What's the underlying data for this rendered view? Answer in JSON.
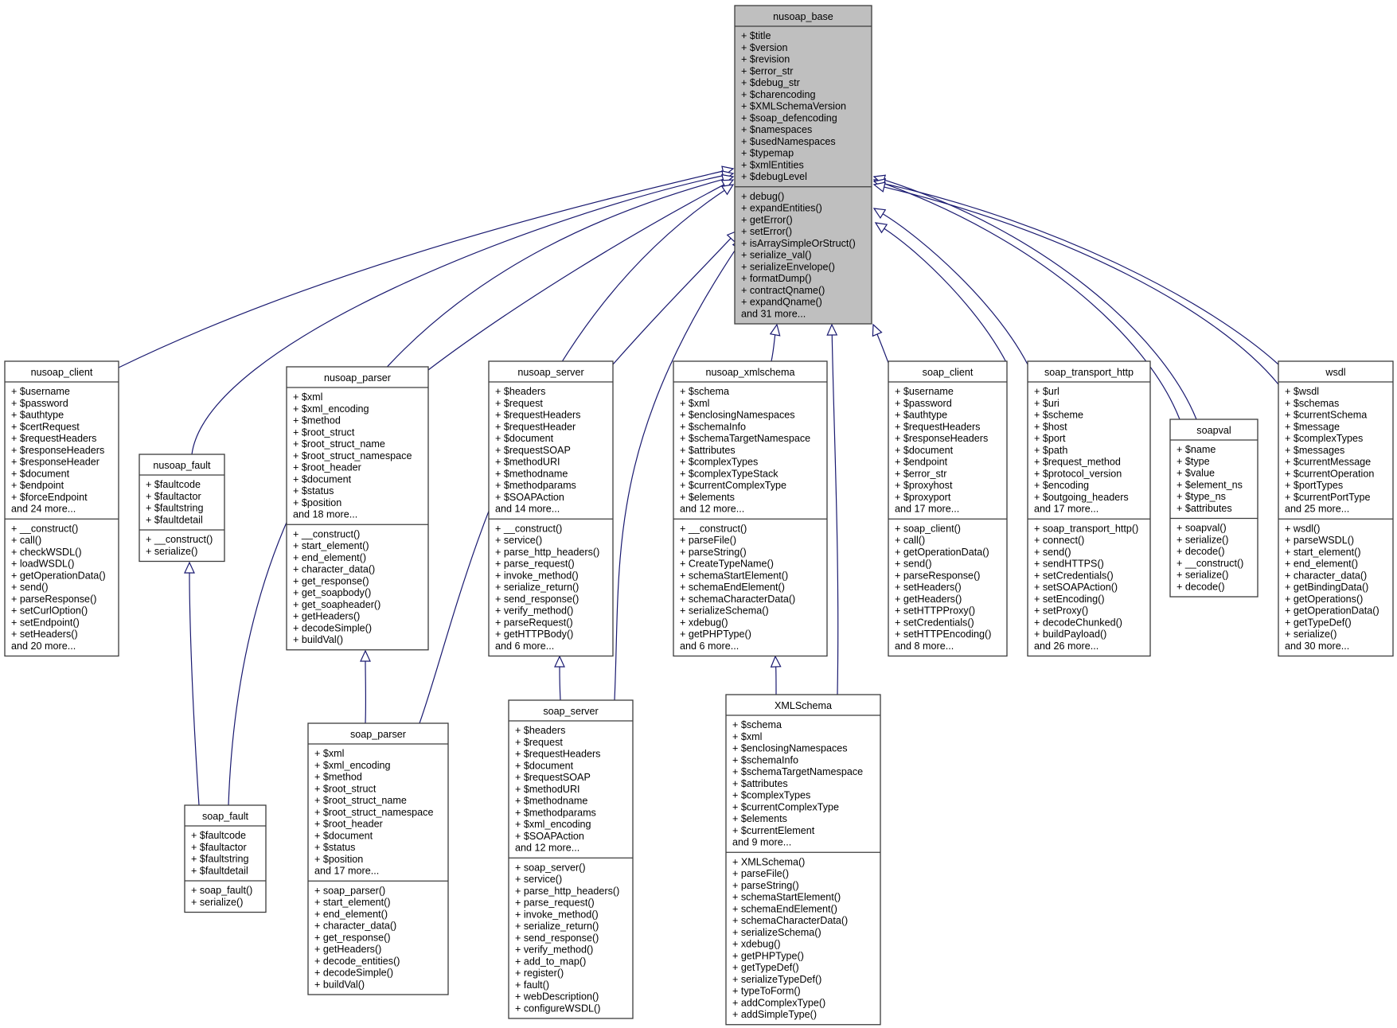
{
  "diagram": {
    "type": "uml-class-inheritance",
    "colors": {
      "edge": "#191970",
      "base_fill": "#bfbfbf",
      "box_fill": "#ffffff",
      "border": "#3c3c3c"
    },
    "classes": [
      {
        "id": "nusoap_base",
        "name": "nusoap_base",
        "highlight": true,
        "attributes": [
          "+ $title",
          "+ $version",
          "+ $revision",
          "+ $error_str",
          "+ $debug_str",
          "+ $charencoding",
          "+ $XMLSchemaVersion",
          "+ $soap_defencoding",
          "+ $namespaces",
          "+ $usedNamespaces",
          "+ $typemap",
          "+ $xmlEntities",
          "+ $debugLevel"
        ],
        "methods": [
          "+ debug()",
          "+ expandEntities()",
          "+ getError()",
          "+ setError()",
          "+ isArraySimpleOrStruct()",
          "+ serialize_val()",
          "+ serializeEnvelope()",
          "+ formatDump()",
          "+ contractQname()",
          "+ expandQname()",
          "and 31 more..."
        ]
      },
      {
        "id": "nusoap_client",
        "name": "nusoap_client",
        "attributes": [
          "+ $username",
          "+ $password",
          "+ $authtype",
          "+ $certRequest",
          "+ $requestHeaders",
          "+ $responseHeaders",
          "+ $responseHeader",
          "+ $document",
          "+ $endpoint",
          "+ $forceEndpoint",
          "and 24 more..."
        ],
        "methods": [
          "+ __construct()",
          "+ call()",
          "+ checkWSDL()",
          "+ loadWSDL()",
          "+ getOperationData()",
          "+ send()",
          "+ parseResponse()",
          "+ setCurlOption()",
          "+ setEndpoint()",
          "+ setHeaders()",
          "and 20 more..."
        ]
      },
      {
        "id": "nusoap_fault",
        "name": "nusoap_fault",
        "attributes": [
          "+ $faultcode",
          "+ $faultactor",
          "+ $faultstring",
          "+ $faultdetail"
        ],
        "methods": [
          "+ __construct()",
          "+ serialize()"
        ]
      },
      {
        "id": "nusoap_parser",
        "name": "nusoap_parser",
        "attributes": [
          "+ $xml",
          "+ $xml_encoding",
          "+ $method",
          "+ $root_struct",
          "+ $root_struct_name",
          "+ $root_struct_namespace",
          "+ $root_header",
          "+ $document",
          "+ $status",
          "+ $position",
          "and 18 more..."
        ],
        "methods": [
          "+ __construct()",
          "+ start_element()",
          "+ end_element()",
          "+ character_data()",
          "+ get_response()",
          "+ get_soapbody()",
          "+ get_soapheader()",
          "+ getHeaders()",
          "+ decodeSimple()",
          "+ buildVal()"
        ]
      },
      {
        "id": "nusoap_server",
        "name": "nusoap_server",
        "attributes": [
          "+ $headers",
          "+ $request",
          "+ $requestHeaders",
          "+ $requestHeader",
          "+ $document",
          "+ $requestSOAP",
          "+ $methodURI",
          "+ $methodname",
          "+ $methodparams",
          "+ $SOAPAction",
          "and 14 more..."
        ],
        "methods": [
          "+ __construct()",
          "+ service()",
          "+ parse_http_headers()",
          "+ parse_request()",
          "+ invoke_method()",
          "+ serialize_return()",
          "+ send_response()",
          "+ verify_method()",
          "+ parseRequest()",
          "+ getHTTPBody()",
          "and 6 more..."
        ]
      },
      {
        "id": "nusoap_xmlschema",
        "name": "nusoap_xmlschema",
        "attributes": [
          "+ $schema",
          "+ $xml",
          "+ $enclosingNamespaces",
          "+ $schemaInfo",
          "+ $schemaTargetNamespace",
          "+ $attributes",
          "+ $complexTypes",
          "+ $complexTypeStack",
          "+ $currentComplexType",
          "+ $elements",
          "and 12 more..."
        ],
        "methods": [
          "+ __construct()",
          "+ parseFile()",
          "+ parseString()",
          "+ CreateTypeName()",
          "+ schemaStartElement()",
          "+ schemaEndElement()",
          "+ schemaCharacterData()",
          "+ serializeSchema()",
          "+ xdebug()",
          "+ getPHPType()",
          "and 6 more..."
        ]
      },
      {
        "id": "soap_client",
        "name": "soap_client",
        "attributes": [
          "+ $username",
          "+ $password",
          "+ $authtype",
          "+ $requestHeaders",
          "+ $responseHeaders",
          "+ $document",
          "+ $endpoint",
          "+ $error_str",
          "+ $proxyhost",
          "+ $proxyport",
          "and 17 more..."
        ],
        "methods": [
          "+ soap_client()",
          "+ call()",
          "+ getOperationData()",
          "+ send()",
          "+ parseResponse()",
          "+ setHeaders()",
          "+ getHeaders()",
          "+ setHTTPProxy()",
          "+ setCredentials()",
          "+ setHTTPEncoding()",
          "and 8 more..."
        ]
      },
      {
        "id": "soap_transport_http",
        "name": "soap_transport_http",
        "attributes": [
          "+ $url",
          "+ $uri",
          "+ $scheme",
          "+ $host",
          "+ $port",
          "+ $path",
          "+ $request_method",
          "+ $protocol_version",
          "+ $encoding",
          "+ $outgoing_headers",
          "and 17 more..."
        ],
        "methods": [
          "+ soap_transport_http()",
          "+ connect()",
          "+ send()",
          "+ sendHTTPS()",
          "+ setCredentials()",
          "+ setSOAPAction()",
          "+ setEncoding()",
          "+ setProxy()",
          "+ decodeChunked()",
          "+ buildPayload()",
          "and 26 more..."
        ]
      },
      {
        "id": "soapval",
        "name": "soapval",
        "attributes": [
          "+ $name",
          "+ $type",
          "+ $value",
          "+ $element_ns",
          "+ $type_ns",
          "+ $attributes"
        ],
        "methods": [
          "+ soapval()",
          "+ serialize()",
          "+ decode()",
          "+ __construct()",
          "+ serialize()",
          "+ decode()"
        ]
      },
      {
        "id": "wsdl",
        "name": "wsdl",
        "attributes": [
          "+ $wsdl",
          "+ $schemas",
          "+ $currentSchema",
          "+ $message",
          "+ $complexTypes",
          "+ $messages",
          "+ $currentMessage",
          "+ $currentOperation",
          "+ $portTypes",
          "+ $currentPortType",
          "and 25 more..."
        ],
        "methods": [
          "+ wsdl()",
          "+ parseWSDL()",
          "+ start_element()",
          "+ end_element()",
          "+ character_data()",
          "+ getBindingData()",
          "+ getOperations()",
          "+ getOperationData()",
          "+ getTypeDef()",
          "+ serialize()",
          "and 30 more..."
        ]
      },
      {
        "id": "soap_fault",
        "name": "soap_fault",
        "attributes": [
          "+ $faultcode",
          "+ $faultactor",
          "+ $faultstring",
          "+ $faultdetail"
        ],
        "methods": [
          "+ soap_fault()",
          "+ serialize()"
        ]
      },
      {
        "id": "soap_parser",
        "name": "soap_parser",
        "attributes": [
          "+ $xml",
          "+ $xml_encoding",
          "+ $method",
          "+ $root_struct",
          "+ $root_struct_name",
          "+ $root_struct_namespace",
          "+ $root_header",
          "+ $document",
          "+ $status",
          "+ $position",
          "and 17 more..."
        ],
        "methods": [
          "+ soap_parser()",
          "+ start_element()",
          "+ end_element()",
          "+ character_data()",
          "+ get_response()",
          "+ getHeaders()",
          "+ decode_entities()",
          "+ decodeSimple()",
          "+ buildVal()"
        ]
      },
      {
        "id": "soap_server",
        "name": "soap_server",
        "attributes": [
          "+ $headers",
          "+ $request",
          "+ $requestHeaders",
          "+ $document",
          "+ $requestSOAP",
          "+ $methodURI",
          "+ $methodname",
          "+ $methodparams",
          "+ $xml_encoding",
          "+ $SOAPAction",
          "and 12 more..."
        ],
        "methods": [
          "+ soap_server()",
          "+ service()",
          "+ parse_http_headers()",
          "+ parse_request()",
          "+ invoke_method()",
          "+ serialize_return()",
          "+ send_response()",
          "+ verify_method()",
          "+ add_to_map()",
          "+ register()",
          "+ fault()",
          "+ webDescription()",
          "+ configureWSDL()"
        ]
      },
      {
        "id": "XMLSchema",
        "name": "XMLSchema",
        "attributes": [
          "+ $schema",
          "+ $xml",
          "+ $enclosingNamespaces",
          "+ $schemaInfo",
          "+ $schemaTargetNamespace",
          "+ $attributes",
          "+ $complexTypes",
          "+ $currentComplexType",
          "+ $elements",
          "+ $currentElement",
          "and 9 more..."
        ],
        "methods": [
          "+ XMLSchema()",
          "+ parseFile()",
          "+ parseString()",
          "+ schemaStartElement()",
          "+ schemaEndElement()",
          "+ schemaCharacterData()",
          "+ serializeSchema()",
          "+ xdebug()",
          "+ getPHPType()",
          "+ getTypeDef()",
          "+ serializeTypeDef()",
          "+ typeToForm()",
          "+ addComplexType()",
          "+ addSimpleType()"
        ]
      }
    ],
    "inheritance": [
      {
        "child": "nusoap_client",
        "parent": "nusoap_base"
      },
      {
        "child": "nusoap_fault",
        "parent": "nusoap_base"
      },
      {
        "child": "soap_fault",
        "parent": "nusoap_base"
      },
      {
        "child": "soap_fault",
        "parent": "nusoap_fault"
      },
      {
        "child": "nusoap_parser",
        "parent": "nusoap_base"
      },
      {
        "child": "soap_parser",
        "parent": "nusoap_base"
      },
      {
        "child": "soap_parser",
        "parent": "nusoap_parser"
      },
      {
        "child": "nusoap_server",
        "parent": "nusoap_base"
      },
      {
        "child": "soap_server",
        "parent": "nusoap_base"
      },
      {
        "child": "soap_server",
        "parent": "nusoap_server"
      },
      {
        "child": "nusoap_xmlschema",
        "parent": "nusoap_base"
      },
      {
        "child": "XMLSchema",
        "parent": "nusoap_base"
      },
      {
        "child": "XMLSchema",
        "parent": "nusoap_xmlschema"
      },
      {
        "child": "soap_client",
        "parent": "nusoap_base"
      },
      {
        "child": "soap_transport_http",
        "parent": "nusoap_base"
      },
      {
        "child": "soapval",
        "parent": "nusoap_base"
      },
      {
        "child": "soapval",
        "parent": "nusoap_base"
      },
      {
        "child": "wsdl",
        "parent": "nusoap_base"
      },
      {
        "child": "wsdl",
        "parent": "nusoap_base"
      },
      {
        "child": "soap_transport_http",
        "parent": "nusoap_base"
      }
    ]
  }
}
